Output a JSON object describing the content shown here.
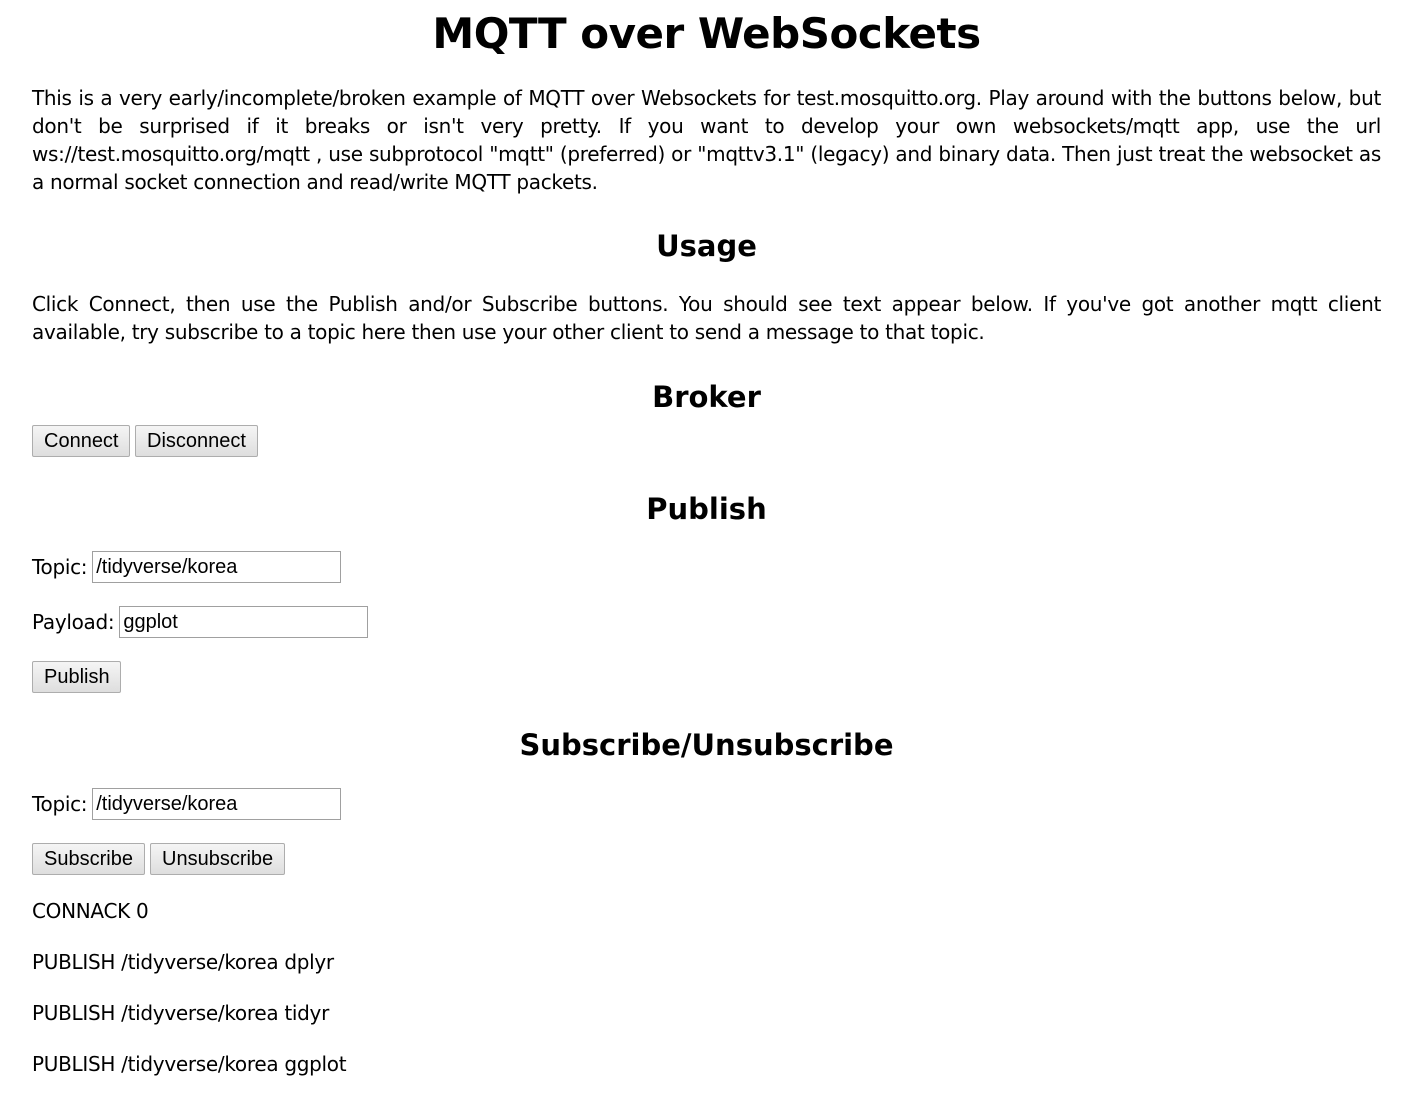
{
  "page": {
    "title": "MQTT over WebSockets",
    "intro": "This is a very early/incomplete/broken example of MQTT over Websockets for test.mosquitto.org. Play around with the buttons below, but don't be surprised if it breaks or isn't very pretty. If you want to develop your own websockets/mqtt app, use the url ws://test.mosquitto.org/mqtt , use subprotocol \"mqtt\" (preferred) or \"mqttv3.1\" (legacy) and binary data. Then just treat the websocket as a normal socket connection and read/write MQTT packets."
  },
  "usage": {
    "heading": "Usage",
    "text": "Click Connect, then use the Publish and/or Subscribe buttons. You should see text appear below. If you've got another mqtt client available, try subscribe to a topic here then use your other client to send a message to that topic."
  },
  "broker": {
    "heading": "Broker",
    "connect_label": "Connect",
    "disconnect_label": "Disconnect"
  },
  "publish": {
    "heading": "Publish",
    "topic_label": "Topic:",
    "topic_value": "/tidyverse/korea",
    "payload_label": "Payload:",
    "payload_value": "ggplot",
    "publish_label": "Publish"
  },
  "subscribe": {
    "heading": "Subscribe/Unsubscribe",
    "topic_label": "Topic:",
    "topic_value": "/tidyverse/korea",
    "subscribe_label": "Subscribe",
    "unsubscribe_label": "Unsubscribe"
  },
  "log": [
    "CONNACK 0",
    "PUBLISH /tidyverse/korea dplyr",
    "PUBLISH /tidyverse/korea tidyr",
    "PUBLISH /tidyverse/korea ggplot"
  ]
}
